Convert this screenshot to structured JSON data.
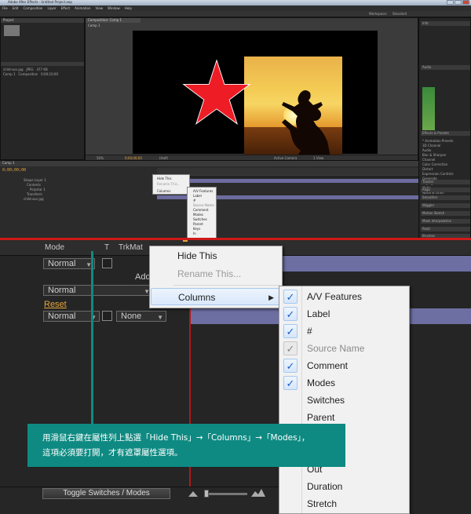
{
  "app": {
    "title": "Adobe After Effects - Untitled Project.aep",
    "menu": [
      "File",
      "Edit",
      "Composition",
      "Layer",
      "Effect",
      "Animation",
      "View",
      "Window",
      "Help"
    ],
    "workspace_label": "Workspace:",
    "workspace_value": "Standard"
  },
  "project_panel": {
    "tab": "Project",
    "items": [
      {
        "name": "child-sun.jpg",
        "type": "JPEG",
        "size": "477 KB"
      },
      {
        "name": "Comp 1",
        "type": "Composition",
        "duration": "0;00;10;00"
      }
    ]
  },
  "comp_panel": {
    "tab": "Composition: Comp 1",
    "sub_tab": "Comp 1",
    "zoom": "50%",
    "timecode": "0;00;00;00",
    "resolution": "(Half)",
    "view": "Active Camera",
    "views": "1 View"
  },
  "right_panels": {
    "info": "Info",
    "audio": "Audio",
    "effects": "Effects & Presets",
    "effects_items": [
      "* Animation Presets",
      "3D Channel",
      "Audio",
      "Blur & Sharpen",
      "Channel",
      "Color Correction",
      "Distort",
      "Expression Controls",
      "Generate",
      "Keying",
      "Matte",
      "Noise & Grain"
    ],
    "tracker": "Tracker",
    "align": "Align",
    "smoother": "Smoother",
    "wiggler": "Wiggler",
    "motion_sketch": "Motion Sketch",
    "mask_interp": "Mask Interpolation",
    "paint": "Paint",
    "brushes": "Brushes"
  },
  "timeline_overview": {
    "tab": "Comp 1",
    "timecode": "0;00;00;00",
    "layers": [
      "Shape Layer 1",
      "Contents",
      "Polystar 1",
      "Transform",
      "child-sun.jpg"
    ],
    "mini_menu": [
      "Hide This",
      "Rename This...",
      "Columns"
    ],
    "mini_submenu": [
      "A/V Features",
      "Label",
      "#",
      "Source Name",
      "Comment",
      "Modes",
      "Switches",
      "Parent",
      "Keys",
      "In",
      "Out",
      "Duration",
      "Stretch"
    ]
  },
  "zoomed": {
    "header": {
      "mode": "Mode",
      "t": "T",
      "trkmat": "TrkMat"
    },
    "row1_mode": "Normal",
    "add_label": "Add",
    "row2_mode": "Normal",
    "reset_label": "Reset",
    "row3_mode": "Normal",
    "row3_trkmat": "None",
    "toggle_button": "Toggle Switches / Modes"
  },
  "context_menu": {
    "hide_this": "Hide This",
    "rename_this": "Rename This...",
    "columns": "Columns"
  },
  "columns_submenu": [
    {
      "label": "A/V Features",
      "checked": true,
      "enabled": true
    },
    {
      "label": "Label",
      "checked": true,
      "enabled": true
    },
    {
      "label": "#",
      "checked": true,
      "enabled": true
    },
    {
      "label": "Source Name",
      "checked": true,
      "enabled": false
    },
    {
      "label": "Comment",
      "checked": true,
      "enabled": true
    },
    {
      "label": "Modes",
      "checked": true,
      "enabled": true
    },
    {
      "label": "Switches",
      "checked": false,
      "enabled": true
    },
    {
      "label": "Parent",
      "checked": false,
      "enabled": true
    },
    {
      "label": "Out",
      "checked": false,
      "enabled": true
    },
    {
      "label": "Duration",
      "checked": false,
      "enabled": true
    },
    {
      "label": "Stretch",
      "checked": false,
      "enabled": true
    }
  ],
  "caption": {
    "line1": "用滑鼠右鍵在屬性列上點選「Hide This」→「Columns」→「Modes」，",
    "line2": "這項必須要打開，才有遮罩屬性選項。"
  },
  "colors": {
    "star": "#ee1c25",
    "accent_teal": "#0e8a82",
    "timeline_bar": "#6d6fa3",
    "highlight_red": "#d01818",
    "orange": "#e8a63a"
  }
}
